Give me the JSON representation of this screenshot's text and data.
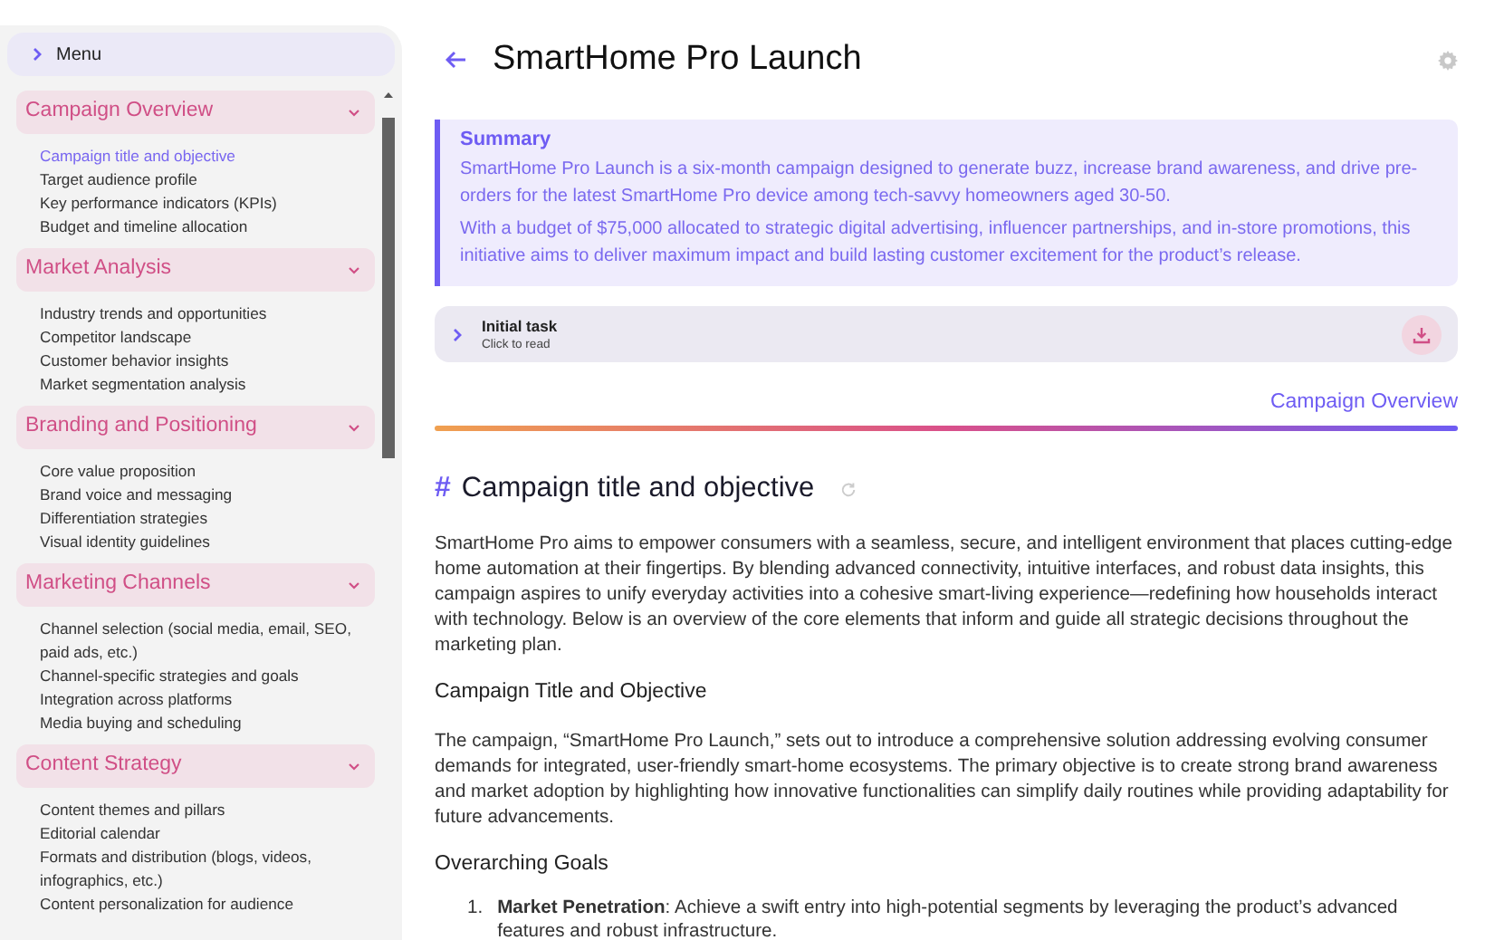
{
  "menu": {
    "label": "Menu"
  },
  "sidebar": {
    "sections": [
      {
        "title": "Campaign Overview",
        "expanded": true,
        "items": [
          {
            "label": "Campaign title and objective",
            "selected": true
          },
          {
            "label": "Target audience profile",
            "selected": false
          },
          {
            "label": "Key performance indicators (KPIs)",
            "selected": false
          },
          {
            "label": "Budget and timeline allocation",
            "selected": false
          }
        ]
      },
      {
        "title": "Market Analysis",
        "expanded": true,
        "items": [
          {
            "label": "Industry trends and opportunities",
            "selected": false
          },
          {
            "label": "Competitor landscape",
            "selected": false
          },
          {
            "label": "Customer behavior insights",
            "selected": false
          },
          {
            "label": "Market segmentation analysis",
            "selected": false
          }
        ]
      },
      {
        "title": "Branding and Positioning",
        "expanded": true,
        "items": [
          {
            "label": "Core value proposition",
            "selected": false
          },
          {
            "label": "Brand voice and messaging",
            "selected": false
          },
          {
            "label": "Differentiation strategies",
            "selected": false
          },
          {
            "label": "Visual identity guidelines",
            "selected": false
          }
        ]
      },
      {
        "title": "Marketing Channels",
        "expanded": true,
        "items": [
          {
            "label": "Channel selection (social media, email, SEO, paid ads, etc.)",
            "selected": false
          },
          {
            "label": "Channel-specific strategies and goals",
            "selected": false
          },
          {
            "label": "Integration across platforms",
            "selected": false
          },
          {
            "label": "Media buying and scheduling",
            "selected": false
          }
        ]
      },
      {
        "title": "Content Strategy",
        "expanded": true,
        "items": [
          {
            "label": "Content themes and pillars",
            "selected": false
          },
          {
            "label": "Editorial calendar",
            "selected": false
          },
          {
            "label": "Formats and distribution (blogs, videos, infographics, etc.)",
            "selected": false
          },
          {
            "label": "Content personalization for audience",
            "selected": false
          }
        ]
      }
    ]
  },
  "header": {
    "title": "SmartHome Pro Launch"
  },
  "summary": {
    "title": "Summary",
    "paragraphs": [
      "SmartHome Pro Launch is a six-month campaign designed to generate buzz, increase brand awareness, and drive pre-orders for the latest SmartHome Pro device among tech-savvy homeowners aged 30-50.",
      "With a budget of $75,000 allocated to strategic digital advertising, influencer partnerships, and in-store promotions, this initiative aims to deliver maximum impact and build lasting customer excitement for the product’s release."
    ]
  },
  "task": {
    "title": "Initial task",
    "subtitle": "Click to read"
  },
  "section_label": "Campaign Overview",
  "article": {
    "heading_mark": "#",
    "heading": "Campaign title and objective",
    "blocks": [
      {
        "kind": "paragraph",
        "text": "SmartHome Pro aims to empower consumers with a seamless, secure, and intelligent environment that places cutting-edge home automation at their fingertips. By blending advanced connectivity, intuitive interfaces, and robust data insights, this campaign aspires to unify everyday activities into a cohesive smart-living experience—redefining how households interact with technology. Below is an overview of the core elements that inform and guide all strategic decisions throughout the marketing plan."
      },
      {
        "kind": "subheading",
        "text": "Campaign Title and Objective"
      },
      {
        "kind": "paragraph",
        "text": "The campaign, “SmartHome Pro Launch,” sets out to introduce a comprehensive solution addressing evolving consumer demands for integrated, user-friendly smart-home ecosystems. The primary objective is to create strong brand awareness and market adoption by highlighting how innovative functionalities can simplify daily routines while providing adaptability for future advancements."
      },
      {
        "kind": "subheading",
        "text": "Overarching Goals"
      },
      {
        "kind": "list",
        "items": [
          {
            "marker": "1.",
            "text": "**Market Penetration**: Achieve a swift entry into high-potential segments by leveraging the product’s advanced features and robust infrastructure."
          }
        ]
      }
    ]
  }
}
